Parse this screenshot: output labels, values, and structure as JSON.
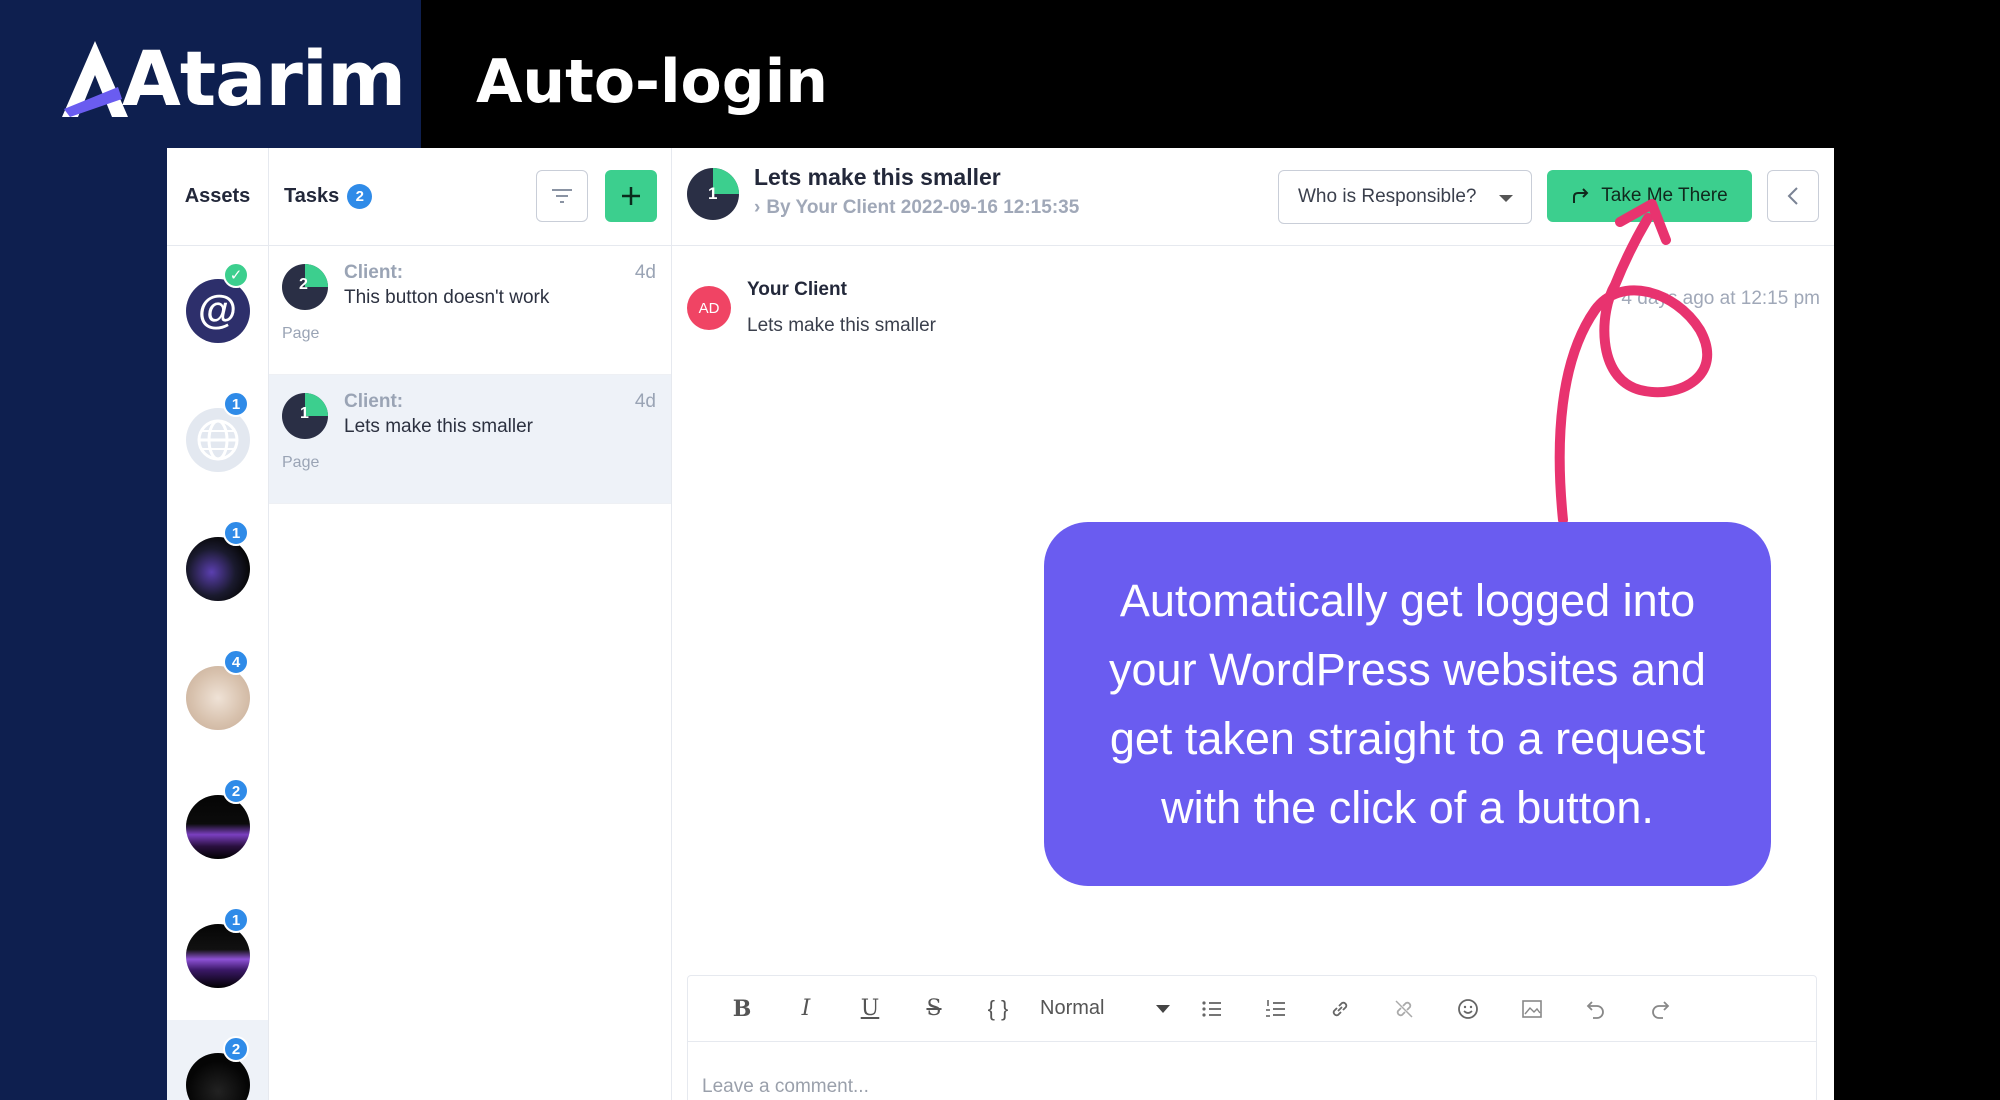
{
  "brand": {
    "name": "Atarim",
    "page_title": "Auto-login"
  },
  "assets": {
    "header": "Assets",
    "items": [
      {
        "badge": "✓",
        "type": "email"
      },
      {
        "badge": "1",
        "type": "web"
      },
      {
        "badge": "1",
        "type": "site"
      },
      {
        "badge": "4",
        "type": "site"
      },
      {
        "badge": "2",
        "type": "site"
      },
      {
        "badge": "1",
        "type": "site"
      },
      {
        "badge": "2",
        "type": "site"
      }
    ]
  },
  "tasks": {
    "header": "Tasks",
    "count": "2",
    "items": [
      {
        "number": "2",
        "from": "Client:",
        "title": "This button doesn't work",
        "age": "4d",
        "type": "Page"
      },
      {
        "number": "1",
        "from": "Client:",
        "title": "Lets make this smaller",
        "age": "4d",
        "type": "Page"
      }
    ]
  },
  "detail": {
    "number": "1",
    "title": "Lets make this smaller",
    "subtitle": "By Your Client 2022-09-16 12:15:35",
    "responsible_label": "Who is Responsible?",
    "take_me_there_label": "Take Me There",
    "comment": {
      "avatar_initials": "AD",
      "author": "Your Client",
      "text": "Lets make this smaller",
      "time": "4 days ago at 12:15 pm"
    },
    "editor": {
      "bold": "B",
      "italic": "I",
      "underline": "U",
      "strike": "S",
      "code": "{ }",
      "format": "Normal",
      "placeholder": "Leave a comment..."
    }
  },
  "callout": {
    "text": "Automatically get logged into your WordPress websites and get taken straight to a request with the click of a button."
  },
  "colors": {
    "brand_navy": "#0e1f4f",
    "accent_green": "#3ccf8e",
    "badge_blue": "#2f8be8",
    "callout_purple": "#6a5cf0",
    "arrow_pink": "#e8336f",
    "avatar_red": "#f04464"
  }
}
